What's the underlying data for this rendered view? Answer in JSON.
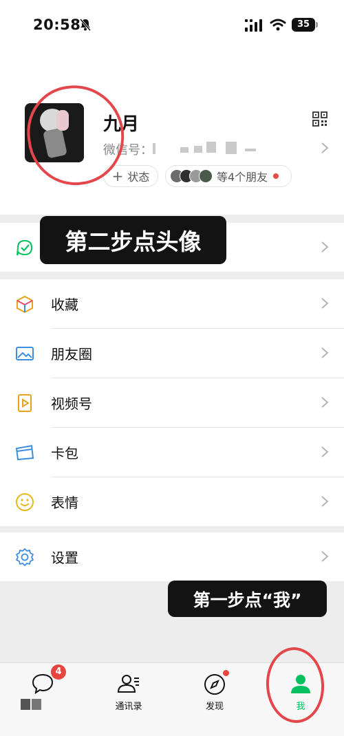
{
  "status_bar": {
    "time": "20:58",
    "battery": "35"
  },
  "profile": {
    "nickname": "九月",
    "wechat_id_label": "微信号：",
    "status_label": "状态",
    "friends_label": "等4个朋友"
  },
  "menu": {
    "services": {
      "label": "服务"
    },
    "items": [
      {
        "label": "收藏",
        "icon": "favorites-icon"
      },
      {
        "label": "朋友圈",
        "icon": "moments-icon"
      },
      {
        "label": "视频号",
        "icon": "channels-icon"
      },
      {
        "label": "卡包",
        "icon": "card-wallet-icon"
      },
      {
        "label": "表情",
        "icon": "sticker-icon"
      }
    ],
    "settings": {
      "label": "设置"
    }
  },
  "annotations": {
    "step2": "第二步点头像",
    "step1": "第一步点“我”"
  },
  "tabbar": {
    "chats": {
      "label": "",
      "badge": "4"
    },
    "contacts": {
      "label": "通讯录"
    },
    "discover": {
      "label": "发现"
    },
    "me": {
      "label": "我"
    }
  },
  "colors": {
    "accent": "#07c160",
    "badge": "#e9453f",
    "annotation_circle": "#e3474b"
  }
}
